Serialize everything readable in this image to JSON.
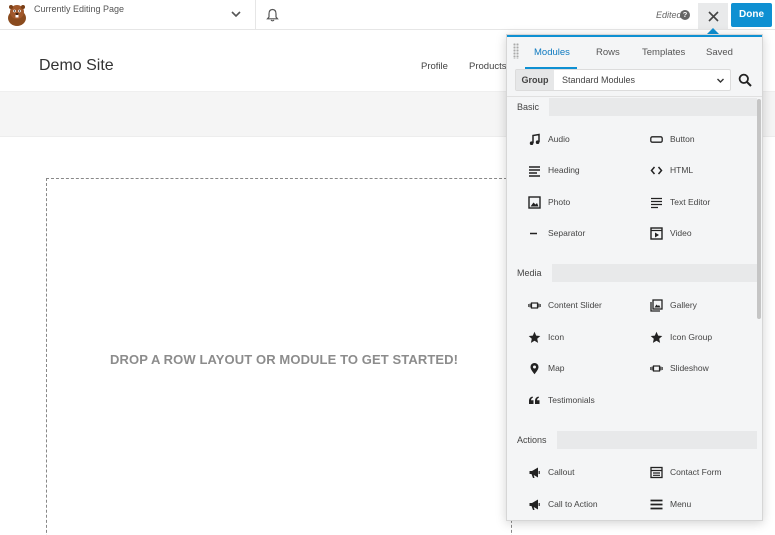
{
  "topbar": {
    "editing_label": "Currently Editing Page",
    "edited_label": "Edited",
    "help_glyph": "?",
    "done_label": "Done",
    "colors": {
      "accent": "#0e90d2",
      "close_bg": "#e9eaeb"
    }
  },
  "site": {
    "title": "Demo Site",
    "nav": [
      "Profile",
      "Products"
    ],
    "drop_message": "DROP A ROW LAYOUT OR MODULE TO GET STARTED!"
  },
  "panel": {
    "tabs": [
      "Modules",
      "Rows",
      "Templates",
      "Saved"
    ],
    "active_tab": "Modules",
    "group_label": "Group",
    "group_value": "Standard Modules",
    "sections": [
      {
        "title": "Basic",
        "modules": [
          {
            "label": "Audio",
            "icon": "music-note-icon"
          },
          {
            "label": "Button",
            "icon": "button-icon"
          },
          {
            "label": "Heading",
            "icon": "heading-icon"
          },
          {
            "label": "HTML",
            "icon": "code-icon"
          },
          {
            "label": "Photo",
            "icon": "photo-icon"
          },
          {
            "label": "Text Editor",
            "icon": "text-editor-icon"
          },
          {
            "label": "Separator",
            "icon": "separator-icon"
          },
          {
            "label": "Video",
            "icon": "video-icon"
          }
        ]
      },
      {
        "title": "Media",
        "modules": [
          {
            "label": "Content Slider",
            "icon": "content-slider-icon"
          },
          {
            "label": "Gallery",
            "icon": "gallery-icon"
          },
          {
            "label": "Icon",
            "icon": "star-icon"
          },
          {
            "label": "Icon Group",
            "icon": "star-icon"
          },
          {
            "label": "Map",
            "icon": "map-pin-icon"
          },
          {
            "label": "Slideshow",
            "icon": "slideshow-icon"
          },
          {
            "label": "Testimonials",
            "icon": "quote-icon"
          }
        ]
      },
      {
        "title": "Actions",
        "modules": [
          {
            "label": "Callout",
            "icon": "megaphone-icon"
          },
          {
            "label": "Contact Form",
            "icon": "contact-form-icon"
          },
          {
            "label": "Call to Action",
            "icon": "megaphone-icon"
          },
          {
            "label": "Menu",
            "icon": "menu-icon"
          }
        ]
      }
    ]
  }
}
